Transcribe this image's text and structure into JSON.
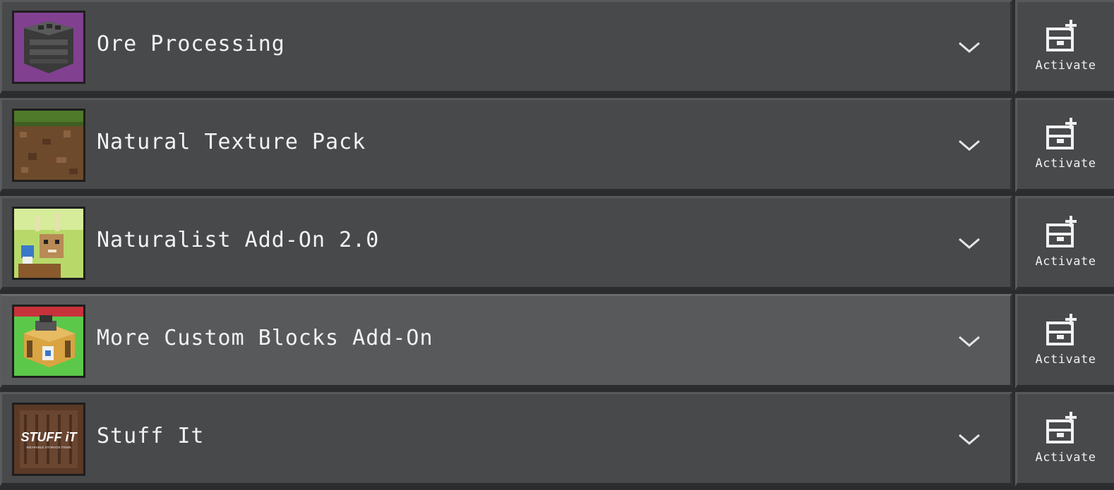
{
  "packs": [
    {
      "title": "Ore Processing",
      "icon": "ore-processing-thumbnail",
      "highlighted": false,
      "action_label": "Activate"
    },
    {
      "title": "Natural Texture Pack",
      "icon": "natural-texture-thumbnail",
      "highlighted": false,
      "action_label": "Activate"
    },
    {
      "title": "Naturalist Add-On 2.0",
      "icon": "naturalist-thumbnail",
      "highlighted": false,
      "action_label": "Activate"
    },
    {
      "title": "More Custom Blocks Add-On",
      "icon": "custom-blocks-thumbnail",
      "highlighted": true,
      "action_label": "Activate"
    },
    {
      "title": "Stuff It",
      "icon": "stuff-it-thumbnail",
      "highlighted": false,
      "action_label": "Activate",
      "thumb_text": "STUFF iT",
      "thumb_subtext": "WEARABLE STORAGE ITEMS"
    }
  ],
  "icons": {
    "expand": "chevron-down-icon",
    "activate": "add-pack-icon"
  },
  "colors": {
    "row_bg": "#48494b",
    "row_highlight": "#58595b",
    "text": "#f2f2f2"
  }
}
